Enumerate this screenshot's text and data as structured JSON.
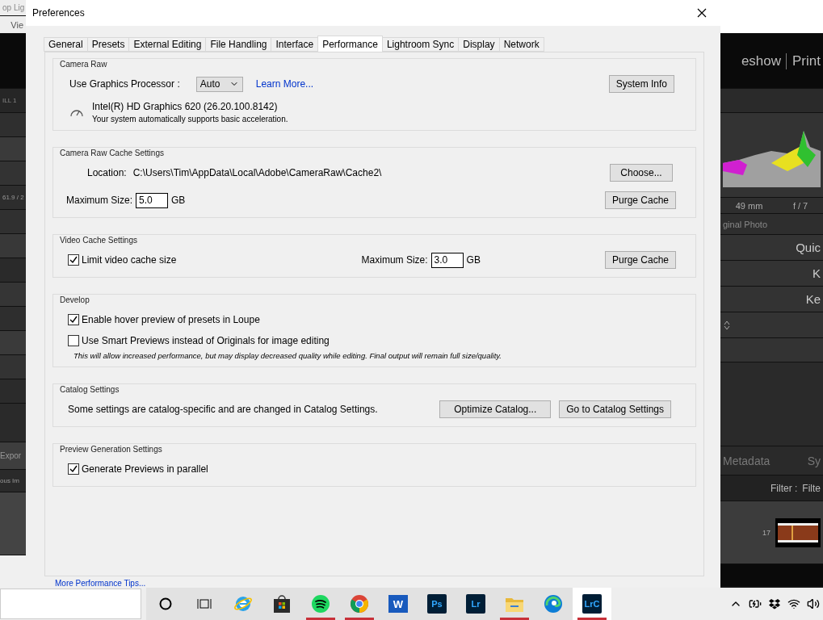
{
  "left_strip": {
    "app_title": "op Lig",
    "menu": "Vie",
    "header": "ILL  1",
    "reading": "61.9 / 2",
    "export_button": "Expor",
    "filmstrip_label": "ous Im"
  },
  "dialog": {
    "title": "Preferences",
    "tabs": [
      {
        "label": "General",
        "selected": false
      },
      {
        "label": "Presets",
        "selected": false
      },
      {
        "label": "External Editing",
        "selected": false
      },
      {
        "label": "File Handling",
        "selected": false
      },
      {
        "label": "Interface",
        "selected": false
      },
      {
        "label": "Performance",
        "selected": true
      },
      {
        "label": "Lightroom Sync",
        "selected": false
      },
      {
        "label": "Display",
        "selected": false
      },
      {
        "label": "Network",
        "selected": false
      }
    ],
    "camera_raw": {
      "heading": "Camera Raw",
      "gpu_label": "Use Graphics Processor :",
      "gpu_select": "Auto",
      "learn_more": "Learn More...",
      "system_info_button": "System Info",
      "gpu_name": "Intel(R) HD Graphics 620 (26.20.100.8142)",
      "gpu_status": "Your system automatically supports basic acceleration."
    },
    "cache": {
      "heading": "Camera Raw Cache Settings",
      "location_label": "Location:",
      "location": "C:\\Users\\Tim\\AppData\\Local\\Adobe\\CameraRaw\\Cache2\\",
      "choose_button": "Choose...",
      "max_label": "Maximum Size:",
      "max_value": "5.0",
      "unit": "GB",
      "purge_button": "Purge Cache"
    },
    "video_cache": {
      "heading": "Video Cache Settings",
      "limit": {
        "label": "Limit video cache size",
        "checked": true
      },
      "max_label": "Maximum Size:",
      "max_value": "3.0",
      "unit": "GB",
      "purge_button": "Purge Cache"
    },
    "develop": {
      "heading": "Develop",
      "options": [
        {
          "label": "Enable hover preview of presets in Loupe",
          "checked": true
        },
        {
          "label": "Use Smart Previews instead of Originals for image editing",
          "checked": false
        }
      ],
      "note": "This will allow increased performance, but may display decreased quality while editing. Final output will remain full size/quality."
    },
    "catalog": {
      "heading": "Catalog Settings",
      "text": "Some settings are catalog-specific and are changed in Catalog Settings.",
      "buttons": [
        "Optimize Catalog...",
        "Go to Catalog Settings"
      ]
    },
    "preview": {
      "heading": "Preview Generation Settings",
      "options": [
        {
          "label": "Generate Previews in parallel",
          "checked": true
        }
      ]
    },
    "tips_link": "More Performance Tips..."
  },
  "right_strip": {
    "modules": [
      "eshow",
      "Print"
    ],
    "focal_length": "49 mm",
    "aperture": "f / 7",
    "photo_label": "ginal Photo",
    "panels": [
      "Quic",
      "K",
      "Ke"
    ],
    "metadata_button": "Metadata",
    "sync_button": "Sy",
    "filter_label": "Filter :",
    "filter_value": "Filte",
    "frame_number": "17"
  },
  "taskbar": {
    "apps": [
      {
        "kind": "cortana",
        "running": false,
        "active": false
      },
      {
        "kind": "taskview",
        "running": false,
        "active": false
      },
      {
        "kind": "ie",
        "running": false,
        "active": false
      },
      {
        "kind": "store",
        "running": false,
        "active": false
      },
      {
        "kind": "spotify",
        "running": true,
        "active": false
      },
      {
        "kind": "chrome",
        "running": true,
        "active": false
      },
      {
        "kind": "word",
        "label": "W",
        "running": false,
        "active": false
      },
      {
        "kind": "tile",
        "label": "Ps",
        "running": false,
        "active": false
      },
      {
        "kind": "tile",
        "label": "Lr",
        "running": false,
        "active": false
      },
      {
        "kind": "explorer",
        "running": true,
        "active": false
      },
      {
        "kind": "edge",
        "running": false,
        "active": false
      },
      {
        "kind": "tile",
        "label": "LrC",
        "running": true,
        "active": true
      }
    ]
  }
}
